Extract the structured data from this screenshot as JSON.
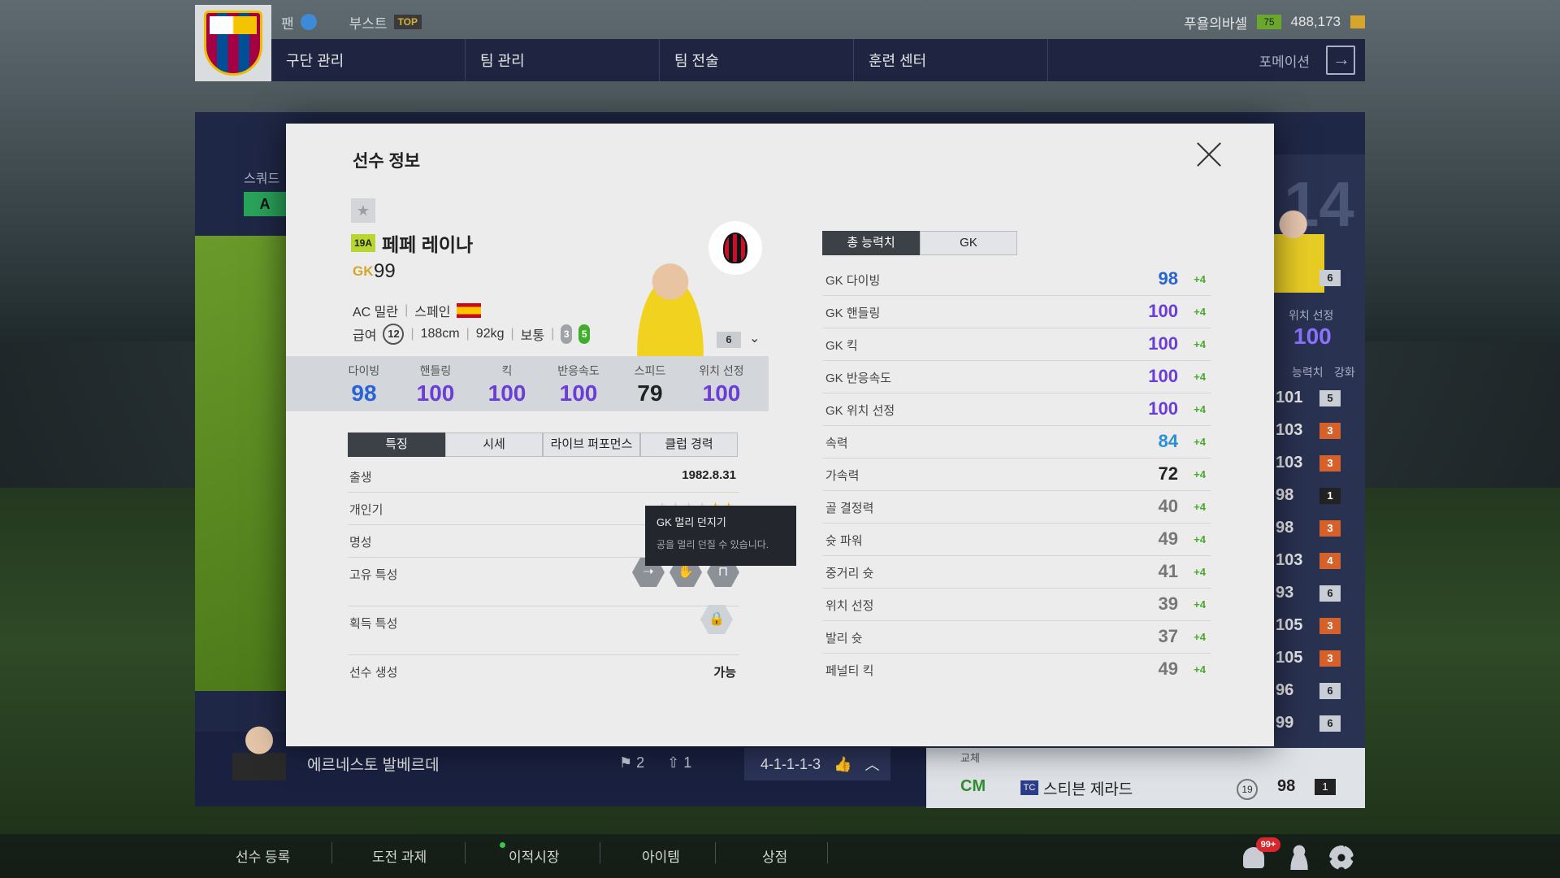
{
  "topbar": {
    "fan_label": "팬",
    "boost_label": "부스트",
    "boost_badge": "TOP",
    "user_name": "푸욜의바셀",
    "user_level": "75",
    "coins": "488,173"
  },
  "nav": {
    "tabs": [
      "구단 관리",
      "팀 관리",
      "팀 전술",
      "훈련 센터"
    ],
    "formation_label": "포메이션"
  },
  "background": {
    "squad_label": "스쿼드",
    "squad_tab": "A",
    "big_number": "14",
    "pos_label": "위치 선정",
    "pos_value": "100",
    "list_header": [
      "능력치",
      "강화"
    ],
    "list_values": [
      "101",
      "103",
      "103",
      "98",
      "98",
      "103",
      "93",
      "105",
      "105",
      "96",
      "99"
    ],
    "list_levels": [
      "5",
      "3",
      "3",
      "1",
      "3",
      "4",
      "6",
      "3",
      "3",
      "6",
      "6"
    ],
    "mini_level": "6",
    "manager_name": "에르네스토 발베르데",
    "stat1": "2",
    "stat2": "1",
    "formation": "4-1-1-1-3",
    "sub_label": "교체",
    "sub_pos": "CM",
    "sub_season": "TC",
    "sub_name": "스티븐 제라드",
    "sub_badge": "19",
    "sub_ovr": "98",
    "sub_lv": "1"
  },
  "modal": {
    "title": "선수 정보",
    "season": "19A",
    "player_name": "페페 레이나",
    "position": "GK",
    "ovr": "99",
    "club": "AC 밀란",
    "nation": "스페인",
    "salary_label": "급여",
    "salary": "12",
    "height": "188cm",
    "weight": "92kg",
    "body": "보통",
    "weak_foot": "3",
    "skill_moves": "5",
    "card_level": "6",
    "gk_stats": [
      {
        "label": "다이빙",
        "value": "98"
      },
      {
        "label": "핸들링",
        "value": "100"
      },
      {
        "label": "킥",
        "value": "100"
      },
      {
        "label": "반응속도",
        "value": "100"
      },
      {
        "label": "스피드",
        "value": "79"
      },
      {
        "label": "위치 선정",
        "value": "100"
      }
    ],
    "tabs": [
      "특징",
      "시세",
      "라이브 퍼포먼스",
      "클럽 경력"
    ],
    "details": {
      "birth_label": "출생",
      "birth": "1982.8.31",
      "popularity_label": "개인기",
      "popularity_stars": 5,
      "fame_label": "명성",
      "unique_label": "고유 특성",
      "acquired_label": "획득 특성",
      "create_label": "선수 생성",
      "create": "가능"
    },
    "tooltip": {
      "title": "GK 멀리 던지기",
      "desc": "공을 멀리 던질 수 있습니다."
    },
    "right_tabs": [
      "총 능력치",
      "GK"
    ],
    "attributes": [
      {
        "label": "GK 다이빙",
        "value": "98",
        "bonus": "+4",
        "color": "#2a63d4"
      },
      {
        "label": "GK 핸들링",
        "value": "100",
        "bonus": "+4",
        "color": "#6a3ed6"
      },
      {
        "label": "GK 킥",
        "value": "100",
        "bonus": "+4",
        "color": "#6a3ed6"
      },
      {
        "label": "GK 반응속도",
        "value": "100",
        "bonus": "+4",
        "color": "#6a3ed6"
      },
      {
        "label": "GK 위치 선정",
        "value": "100",
        "bonus": "+4",
        "color": "#6a3ed6"
      },
      {
        "label": "속력",
        "value": "84",
        "bonus": "+4",
        "color": "#2a8fd4"
      },
      {
        "label": "가속력",
        "value": "72",
        "bonus": "+4",
        "color": "#222222"
      },
      {
        "label": "골 결정력",
        "value": "40",
        "bonus": "+4",
        "color": "#777777"
      },
      {
        "label": "슛 파워",
        "value": "49",
        "bonus": "+4",
        "color": "#777777"
      },
      {
        "label": "중거리 슛",
        "value": "41",
        "bonus": "+4",
        "color": "#777777"
      },
      {
        "label": "위치 선정",
        "value": "39",
        "bonus": "+4",
        "color": "#777777"
      },
      {
        "label": "발리 슛",
        "value": "37",
        "bonus": "+4",
        "color": "#777777"
      },
      {
        "label": "페널티 킥",
        "value": "49",
        "bonus": "+4",
        "color": "#777777"
      }
    ]
  },
  "footer": {
    "items": [
      "선수 등록",
      "도전 과제",
      "이적시장",
      "아이템",
      "상점"
    ],
    "notif": "99+"
  }
}
